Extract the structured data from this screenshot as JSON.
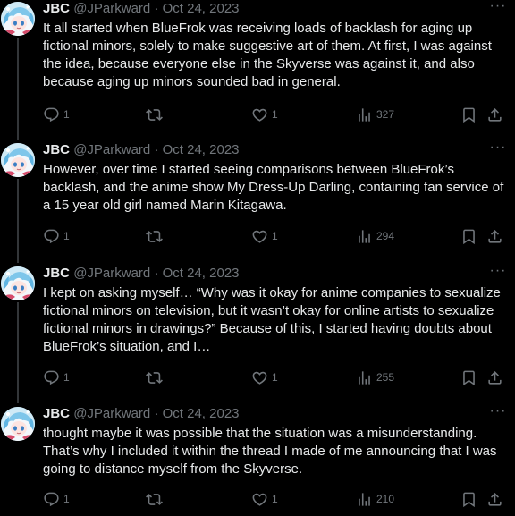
{
  "colors": {
    "background": "#000000",
    "text": "#e7e9ea",
    "secondary": "#71767b",
    "divider": "#2f3336"
  },
  "tweets": [
    {
      "name": "JBC",
      "handle": "@JParkward",
      "dot": "·",
      "date": "Oct 24, 2023",
      "more": "···",
      "text": "It all started when BlueFrok was receiving loads of backlash for aging up fictional minors, solely to make suggestive art of them. At first, I was against the idea, because everyone else in the Skyverse was against it, and also because aging up minors sounded bad in general.",
      "replies": "1",
      "retweets": "",
      "likes": "1",
      "views": "327"
    },
    {
      "name": "JBC",
      "handle": "@JParkward",
      "dot": "·",
      "date": "Oct 24, 2023",
      "more": "···",
      "text": "However, over time I started seeing comparisons between BlueFrok’s backlash, and the anime show My Dress-Up Darling, containing fan service of a 15 year old girl named Marin Kitagawa.",
      "replies": "1",
      "retweets": "",
      "likes": "1",
      "views": "294"
    },
    {
      "name": "JBC",
      "handle": "@JParkward",
      "dot": "·",
      "date": "Oct 24, 2023",
      "more": "···",
      "text": "I kept on asking myself… “Why was it okay for anime companies to sexualize fictional minors on television, but it wasn’t okay for online artists to sexualize fictional minors in drawings?” Because of this, I started having doubts about BlueFrok’s situation, and I…",
      "replies": "1",
      "retweets": "",
      "likes": "1",
      "views": "255"
    },
    {
      "name": "JBC",
      "handle": "@JParkward",
      "dot": "·",
      "date": "Oct 24, 2023",
      "more": "···",
      "text": "thought maybe it was possible that the situation was a misunderstanding. That’s why I included it within the thread I made of me announcing that I was going to distance myself from the Skyverse.",
      "replies": "1",
      "retweets": "",
      "likes": "1",
      "views": "210"
    }
  ],
  "icons": {
    "reply": "reply-icon",
    "retweet": "retweet-icon",
    "like": "heart-icon",
    "views": "views-chart-icon",
    "bookmark": "bookmark-icon",
    "share": "share-icon",
    "more": "more-options-icon",
    "avatar": "avatar"
  }
}
